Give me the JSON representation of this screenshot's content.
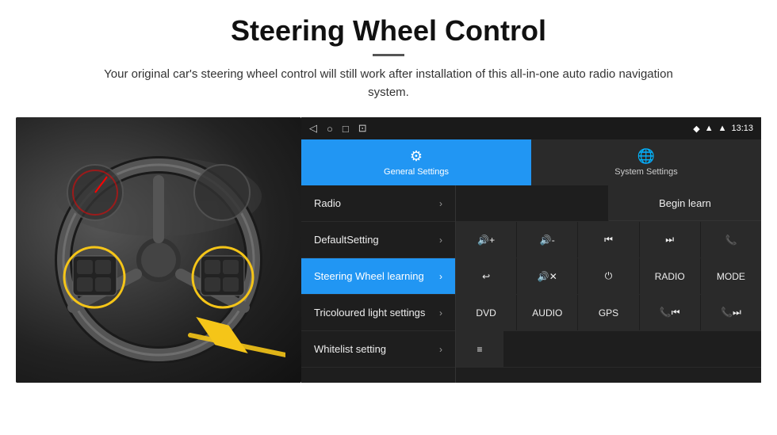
{
  "header": {
    "title": "Steering Wheel Control",
    "subtitle": "Your original car's steering wheel control will still work after installation of this all-in-one auto radio navigation system."
  },
  "android": {
    "status_bar": {
      "back_icon": "◁",
      "home_icon": "○",
      "recent_icon": "□",
      "screenshot_icon": "⊡",
      "signal_icon": "▲",
      "wifi_icon": "▲",
      "time": "13:13"
    },
    "tabs": {
      "general": "General Settings",
      "system": "System Settings"
    },
    "menu": {
      "items": [
        {
          "label": "Radio",
          "active": false
        },
        {
          "label": "DefaultSetting",
          "active": false
        },
        {
          "label": "Steering Wheel learning",
          "active": true
        },
        {
          "label": "Tricoloured light settings",
          "active": false
        },
        {
          "label": "Whitelist setting",
          "active": false
        }
      ]
    },
    "controls": {
      "begin_learn": "Begin learn",
      "row1": [
        "🔊+",
        "🔊-",
        "⏮",
        "⏭",
        "📞"
      ],
      "row2": [
        "↩",
        "🔊✕",
        "⏻",
        "RADIO",
        "MODE"
      ],
      "row3": [
        "DVD",
        "AUDIO",
        "GPS",
        "📞⏮",
        "📞⏭"
      ],
      "row4_icon": "≡"
    }
  }
}
